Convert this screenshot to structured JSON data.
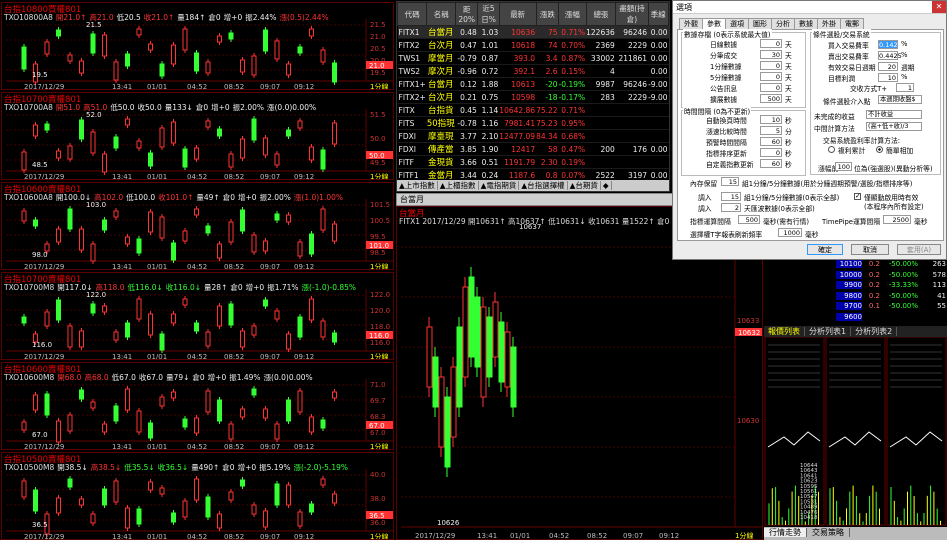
{
  "minis": [
    {
      "title": "台指10800買權801",
      "code": "TXO10800A8",
      "info": [
        {
          "t": "開21.0↑",
          "c": "r"
        },
        {
          "t": "高21.0",
          "c": "r"
        },
        {
          "t": "低20.5",
          "c": "w"
        },
        {
          "t": "收21.0↑",
          "c": "r"
        },
        {
          "t": "量184↑",
          "c": "w"
        },
        {
          "t": "倉0",
          "c": "w"
        },
        {
          "t": "增+0",
          "c": "w"
        },
        {
          "t": "振2.44%",
          "c": "w"
        },
        {
          "t": "漲(0.5)2.44%",
          "c": "r"
        }
      ],
      "hi": "21.5",
      "lo": "19.5",
      "ticks": [
        "21.5",
        "21.0",
        "20.5",
        "20.0",
        "19.5"
      ],
      "last": "21.0",
      "dates": [
        "2017/12/29",
        "13:41",
        "01/01",
        "04:52",
        "08:52",
        "09:07",
        "09:12",
        "1分線"
      ]
    },
    {
      "title": "台指10700賣權801",
      "code": "TXO10700A8",
      "info": [
        {
          "t": "開51.0",
          "c": "r"
        },
        {
          "t": "高51.0",
          "c": "r"
        },
        {
          "t": "低50.0",
          "c": "w"
        },
        {
          "t": "收50.0",
          "c": "w"
        },
        {
          "t": "量133↓",
          "c": "w"
        },
        {
          "t": "倉0",
          "c": "w"
        },
        {
          "t": "增+0",
          "c": "w"
        },
        {
          "t": "振2.00%",
          "c": "w"
        },
        {
          "t": "漲(0.0)0.00%",
          "c": "w"
        }
      ],
      "hi": "52.0",
      "lo": "48.5",
      "ticks": [
        "51.5",
        "50.0",
        "49.5"
      ],
      "last": "50.0",
      "dates": [
        "2017/12/29",
        "13:41",
        "01/01",
        "04:52",
        "08:52",
        "09:07",
        "09:12",
        "1分線"
      ]
    },
    {
      "title": "台指10600賣權801",
      "code": "TXO10600A8",
      "info": [
        {
          "t": "開100.0↓",
          "c": "w"
        },
        {
          "t": "高102.0",
          "c": "r"
        },
        {
          "t": "低100.0",
          "c": "w"
        },
        {
          "t": "收101.0↑",
          "c": "r"
        },
        {
          "t": "量49↑",
          "c": "w"
        },
        {
          "t": "倉0",
          "c": "w"
        },
        {
          "t": "增+0",
          "c": "w"
        },
        {
          "t": "振2.00%",
          "c": "w"
        },
        {
          "t": "漲(1.0)1.00%",
          "c": "r"
        }
      ],
      "hi": "103.0",
      "lo": "98.0",
      "ticks": [
        "101.5",
        "100.5",
        "99.5",
        "98.5"
      ],
      "last": "101.0",
      "dates": [
        "2017/12/29",
        "13:41",
        "01/01",
        "04:52",
        "08:52",
        "09:07",
        "09:12",
        "1分線"
      ]
    },
    {
      "title": "台指10700賣權801",
      "code": "TXO10700M8",
      "info": [
        {
          "t": "開117.0↓",
          "c": "w"
        },
        {
          "t": "高118.0",
          "c": "r"
        },
        {
          "t": "低116.0↓",
          "c": "g"
        },
        {
          "t": "收116.0↓",
          "c": "g"
        },
        {
          "t": "量28↑",
          "c": "w"
        },
        {
          "t": "倉0",
          "c": "w"
        },
        {
          "t": "增+0",
          "c": "w"
        },
        {
          "t": "振1.71%",
          "c": "w"
        },
        {
          "t": "漲(-1.0)-0.85%",
          "c": "g"
        }
      ],
      "hi": "122.0",
      "lo": "116.0",
      "ticks": [
        "122.0",
        "120.0",
        "118.0",
        "116.0"
      ],
      "last": "116.0",
      "dates": [
        "2017/12/29",
        "13:41",
        "01/01",
        "04:52",
        "08:52",
        "09:07",
        "09:12",
        "1分線"
      ]
    },
    {
      "title": "台指10600賣權801",
      "code": "TXO10600M8",
      "info": [
        {
          "t": "開68.0",
          "c": "r"
        },
        {
          "t": "高68.0",
          "c": "r"
        },
        {
          "t": "低67.0",
          "c": "w"
        },
        {
          "t": "收67.0",
          "c": "w"
        },
        {
          "t": "量79↓",
          "c": "w"
        },
        {
          "t": "倉0",
          "c": "w"
        },
        {
          "t": "增+0",
          "c": "w"
        },
        {
          "t": "振1.49%",
          "c": "w"
        },
        {
          "t": "漲(0.0)0.00%",
          "c": "w"
        }
      ],
      "hi": "",
      "lo": "67.0",
      "ticks": [
        "71.0",
        "69.7",
        "68.3",
        "67.0"
      ],
      "last": "67.0",
      "dates": [
        "2017/12/29",
        "13:41",
        "01/01",
        "04:52",
        "08:52",
        "09:07",
        "09:12",
        "1分線"
      ]
    },
    {
      "title": "台指10500賣權801",
      "code": "TXO10500M8",
      "info": [
        {
          "t": "開38.5↓",
          "c": "w"
        },
        {
          "t": "高38.5↓",
          "c": "r"
        },
        {
          "t": "低35.5↓",
          "c": "g"
        },
        {
          "t": "收36.5↓",
          "c": "g"
        },
        {
          "t": "量490↑",
          "c": "w"
        },
        {
          "t": "倉0",
          "c": "w"
        },
        {
          "t": "增+0",
          "c": "w"
        },
        {
          "t": "振5.19%",
          "c": "w"
        },
        {
          "t": "漲(-2.0)-5.19%",
          "c": "g"
        }
      ],
      "hi": "",
      "lo": "36.5",
      "ticks": [
        "40.0",
        "38.0",
        "36.0"
      ],
      "last": "36.5",
      "dates": [
        "2017/12/29",
        "13:41",
        "01/01",
        "04:52",
        "08:52",
        "09:07",
        "09:12",
        "1分線"
      ]
    }
  ],
  "quote": {
    "headers": [
      "代碼",
      "名稱",
      "距20%",
      "近5日%",
      "最新",
      "漲跌",
      "漲幅",
      "總張",
      "盡額(持倉)",
      "季線"
    ],
    "rows": [
      [
        "FITX1",
        "台當月",
        "0.48",
        "1.03",
        "10636",
        "75",
        "0.71%",
        "122636",
        "96246",
        "0.00"
      ],
      [
        "FITX2",
        "台次月",
        "0.47",
        "1.01",
        "10618",
        "74",
        "0.70%",
        "2369",
        "2229",
        "0.00"
      ],
      [
        "TWS1",
        "摩當月",
        "-0.79",
        "0.87",
        "393.0",
        "3.4",
        "0.87%",
        "33002",
        "211861",
        "0.00"
      ],
      [
        "TWS2",
        "摩次月",
        "-0.96",
        "0.72",
        "392.1",
        "2.6",
        "0.15%",
        "4",
        "",
        "0.00"
      ],
      [
        "FITX1+",
        "台當月",
        "0.12",
        "1.88",
        "10613",
        "-20",
        "-0.19%",
        "9987",
        "96246",
        "-9.00"
      ],
      [
        "FITX2+",
        "台次月",
        "0.21",
        "0.75",
        "10598",
        "-18",
        "-0.17%",
        "283",
        "2229",
        "-9.00"
      ],
      [
        "FITX",
        "台指貨",
        "0.45",
        "1.14",
        "10642.86",
        "75.22",
        "0.71%",
        "",
        "",
        " "
      ],
      [
        "FITS",
        "50指現",
        "-0.78",
        "1.16",
        "7981.41",
        "75.23",
        "0.95%",
        "",
        "",
        ""
      ],
      [
        "FDXI",
        "摩臺現",
        "3.77",
        "2.10",
        "12477.09",
        "84.34",
        "0.68%",
        "",
        "",
        ""
      ],
      [
        "FDXI",
        "傳產當",
        "3.85",
        "1.90",
        "12417",
        "58",
        "0.47%",
        "200",
        "176",
        "0.00"
      ],
      [
        "FITF",
        "金現貨",
        "3.66",
        "0.51",
        "1191.79",
        "2.30",
        "0.19%",
        "",
        "",
        ""
      ],
      [
        "FITF1",
        "金當月",
        "3.44",
        "0.24",
        "1187.6",
        "0.8",
        "0.07%",
        "2522",
        "3197",
        "0.00"
      ],
      [
        "FITE",
        "電現貨",
        "-2.09",
        "0.74",
        "441.53",
        "3.72",
        "0.85%",
        "",
        "",
        ""
      ],
      [
        "FITE1",
        "電當月",
        "-2.05",
        "0.67",
        "441.20",
        "3.90",
        "0.89%",
        "3814",
        "2962",
        "0.00"
      ]
    ],
    "tabs": [
      "▲上市指數",
      "▲上櫃指數",
      "▲電指期貨",
      "▲台指選擇權",
      "▲台期貨",
      "◆"
    ]
  },
  "big": {
    "title": "台當月",
    "info": "FITX1  2017/12/29  開10631↑ 高10637↑ 低10631↓ 收10631  量1522↑ 倉0 振0.06% 漲",
    "hi": "10637",
    "lo": "10626",
    "ticks": [
      "10633",
      "10630"
    ],
    "last": "10632",
    "dates": [
      "2017/12/29",
      "13:41",
      "01/01",
      "04:52",
      "08:52",
      "09:07",
      "09:12",
      "1分線"
    ]
  },
  "dialog": {
    "title": "選項",
    "close": "✕",
    "tabs": [
      "外觀",
      "參數",
      "選項",
      "圖形",
      "分析",
      "數據",
      "外掛",
      "電郵"
    ],
    "active_tab": "參數",
    "left_title": "數據存檔 (0表示系統最大值)",
    "left_rows": [
      [
        "日線數據",
        "0",
        "天"
      ],
      [
        "分筆成交",
        "30",
        "天"
      ],
      [
        "1分鐘數據",
        "0",
        "天"
      ],
      [
        "5分鐘數據",
        "0",
        "天"
      ],
      [
        "公告訊息",
        "0",
        "天"
      ],
      [
        "擴展數據",
        "500",
        "天"
      ]
    ],
    "mid_title": "時間間隔 (0為不更新)",
    "mid_rows": [
      [
        "自動換頁時間",
        "10",
        "秒"
      ],
      [
        "漲速比較時間",
        "5",
        "分"
      ],
      [
        "預警時間間隔",
        "60",
        "秒"
      ],
      [
        "指標排序更新",
        "0",
        "秒"
      ],
      [
        "自定義指數更新",
        "60",
        "秒"
      ]
    ],
    "right_title": "條件選股/交易系統",
    "right_rows": [
      [
        "買入交易費率",
        "0.1425",
        "%"
      ],
      [
        "賣出交易費率",
        "0.4425",
        "%"
      ],
      [
        "有效交易日週期",
        "20",
        "週期"
      ],
      [
        "目標利潤",
        "10",
        "%"
      ]
    ],
    "trade_label": "交收方式T+",
    "trade_val": "1",
    "cond_label": "條件選股介入點",
    "cond_sel": "本週期收盤$",
    "unfinished_label": "未完成的收益",
    "unfinished_sel": "不計收益",
    "mid_calc_label": "中間計算方法",
    "mid_calc_sel": "(高+低+收)/3",
    "profit_label": "交易系統盈利率計算方法:",
    "radio1": "複利累計",
    "radio2": "簡單相加",
    "range_label": "漲幅前",
    "range_val": "100",
    "range_unit": "位為(強選股)(異動分析等)",
    "mem_label": "內存保留",
    "mem_val": "15",
    "mem_unit": "組1分鐘/5分鐘數據(用於分鐘週期預警/選股/指標排序等)",
    "call1_label": "調入",
    "call1_val": "15",
    "call1_unit": "組1分鐘/5分鐘數據(0表示全部)",
    "call2_label": "調入",
    "call2_val": "2",
    "call2_unit": "天匯波數據(0表示全部)",
    "chk_label": "僅顯動啟用時有效",
    "chk_sub": "(本程序內所有設定)",
    "idx_label": "指標運算間隔",
    "idx_val": "500",
    "idx_unit": "毫秒(需有行情)",
    "pipe_label": "TimePipe運算間隔",
    "pipe_val": "2500",
    "pipe_unit": "毫秒",
    "refresh_label": "選擇權T字報表刷新頻率",
    "refresh_val": "1000",
    "refresh_unit": "毫秒",
    "ok": "確定",
    "cancel": "取消",
    "apply": "套用(A)"
  },
  "right": {
    "ladder": [
      [
        "10100",
        "0.2",
        "-50.00%",
        "263"
      ],
      [
        "10000",
        "0.2",
        "-50.00%",
        "578"
      ],
      [
        "9900",
        "0.2",
        "-33.33%",
        "113"
      ],
      [
        "9800",
        "0.2",
        "-50.00%",
        "41"
      ],
      [
        "9700",
        "0.1",
        "-50.00%",
        "55"
      ],
      [
        "9600",
        "",
        "",
        ""
      ]
    ],
    "tabs": [
      "報價列表",
      "分析列表1",
      "分析列表2"
    ],
    "bottom_tabs": [
      "行情走勢",
      "交易策略"
    ],
    "grid_rows": [
      "10644",
      "10643",
      "10641",
      "10623",
      "10595",
      "10561",
      "10547",
      "10531",
      "10489",
      "10476",
      "10418"
    ]
  }
}
